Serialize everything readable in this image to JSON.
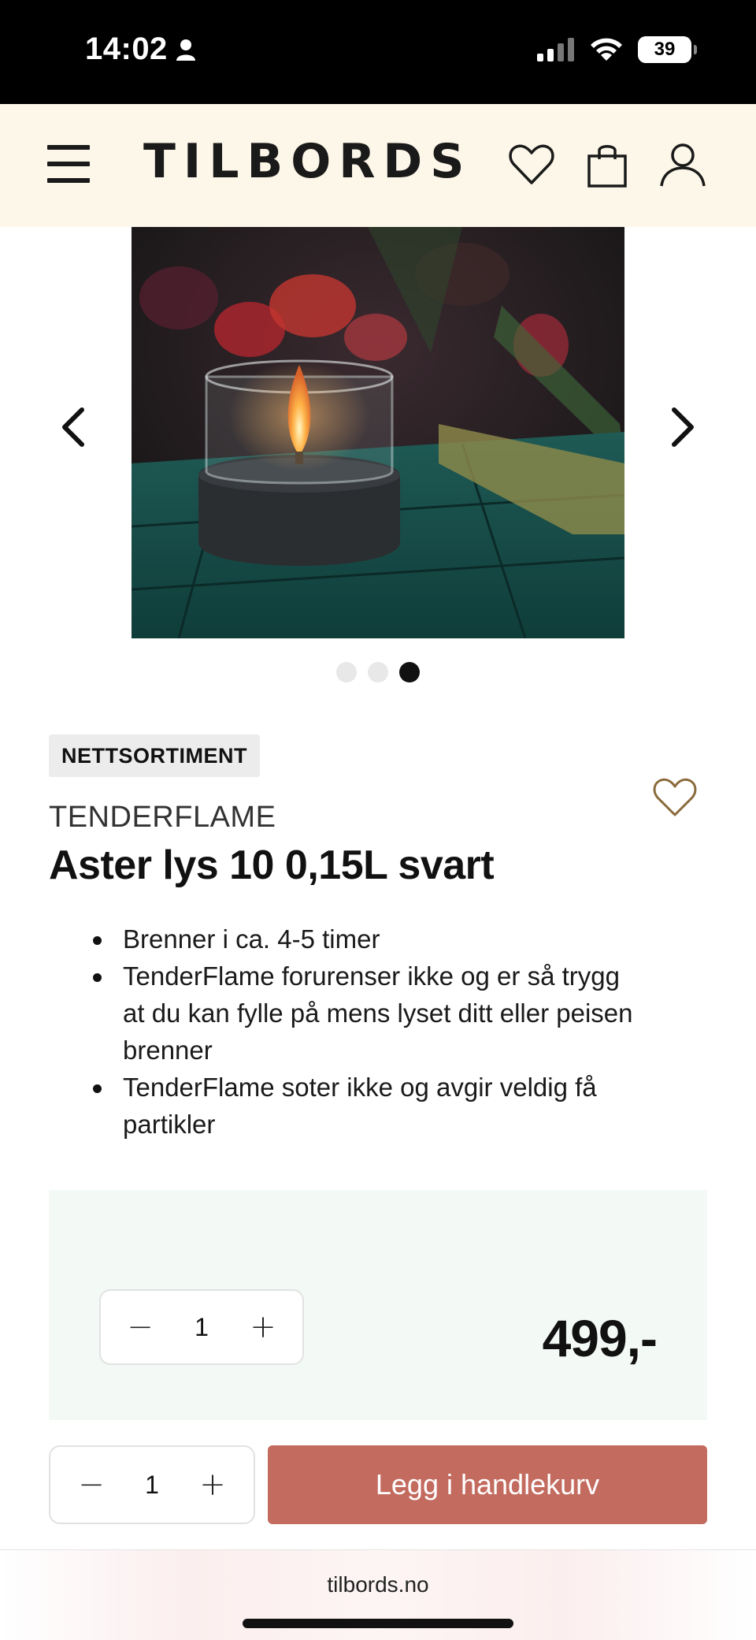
{
  "status_bar": {
    "time": "14:02",
    "battery": "39",
    "icons": [
      "person-icon",
      "signal-icon",
      "wifi-icon",
      "battery-icon"
    ]
  },
  "header": {
    "logo": "TILBORDS",
    "icons": [
      "menu-icon",
      "heart-icon",
      "shopping-bag-icon",
      "user-icon"
    ]
  },
  "carousel": {
    "image_alt": "Tenderflame table lamp with glowing flame in glass cylinder on black base, tulips in background",
    "dots_count": 3,
    "active_dot": 3,
    "icons": [
      "chevron-left-icon",
      "chevron-right-icon"
    ]
  },
  "product": {
    "badge": "NETTSORTIMENT",
    "brand": "TENDERFLAME",
    "title": "Aster lys 10 0,15L svart",
    "features": [
      "Brenner i ca. 4-5 timer",
      "TenderFlame forurenser ikke og er så trygg at du kan fylle på mens lyset ditt eller peisen brenner",
      "TenderFlame soter ikke og avgir veldig få partikler"
    ]
  },
  "purchase": {
    "quantity": "1",
    "price": "499,-",
    "minus_symbol": "−",
    "plus_symbol": "+",
    "add_to_cart_label": "Legg i handlekurv"
  },
  "browser": {
    "url": "tilbords.no"
  },
  "colors": {
    "header_bg": "#fcf7e8",
    "price_panel_bg": "#f3faf6",
    "cta": "#c36b5f",
    "favorite_accent": "#8a6a3c"
  }
}
